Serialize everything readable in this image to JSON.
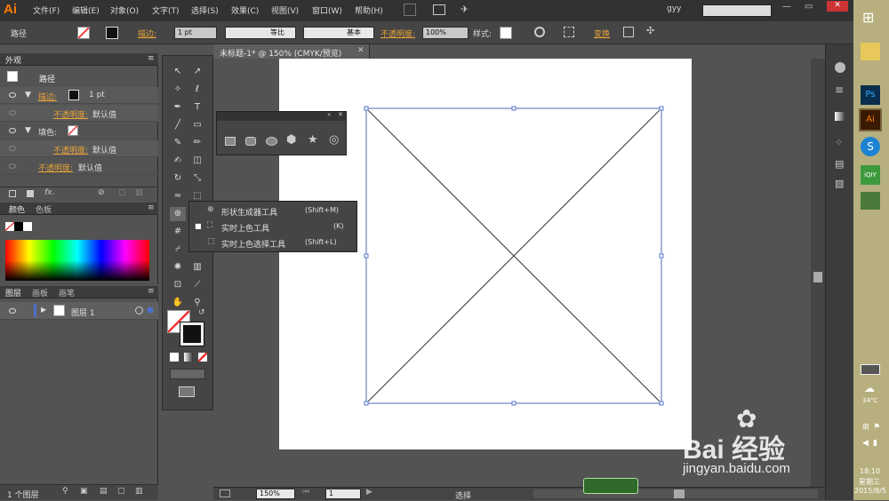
{
  "app": {
    "logo": "Ai"
  },
  "menubar": {
    "items": [
      "文件(F)",
      "编辑(E)",
      "对象(O)",
      "文字(T)",
      "选择(S)",
      "效果(C)",
      "视图(V)",
      "窗口(W)",
      "帮助(H)"
    ],
    "user": "gyy",
    "window_controls": [
      "—",
      "▭",
      "✕"
    ]
  },
  "control_bar": {
    "object_type": "路径",
    "stroke_label": "描边:",
    "stroke_weight": "1 pt",
    "stroke_profile": "等比",
    "brush": "基本",
    "opacity_label": "不透明度:",
    "opacity_value": "100%",
    "style_label": "样式:",
    "transform_label": "变换"
  },
  "appearance_panel": {
    "tab": "外观",
    "header": "路径",
    "rows": [
      {
        "label": "描边:",
        "value": "1 pt"
      },
      {
        "label": "不透明度:",
        "value": "默认值"
      },
      {
        "label": "填色:",
        "value": ""
      },
      {
        "label": "不透明度:",
        "value": "默认值"
      },
      {
        "label": "不透明度:",
        "value": "默认值"
      }
    ]
  },
  "color_panel": {
    "tabs": [
      "颜色",
      "色板"
    ]
  },
  "layers_panel": {
    "tabs": [
      "图层",
      "画板",
      "画笔"
    ],
    "layer_name": "图层 1",
    "count": "1 个图层"
  },
  "document": {
    "tab_title": "未标题-1* @ 150% (CMYK/预览)"
  },
  "flyout_menu": {
    "items": [
      {
        "label": "形状生成器工具",
        "shortcut": "(Shift+M)"
      },
      {
        "label": "实时上色工具",
        "shortcut": "(K)"
      },
      {
        "label": "实时上色选择工具",
        "shortcut": "(Shift+L)"
      }
    ]
  },
  "statusbar": {
    "zoom": "150%",
    "page": "1",
    "tool": "选择"
  },
  "taskbar": {
    "weather": "34°C",
    "time": "18:10",
    "day": "星期三",
    "date": "2015/8/5"
  },
  "watermark": {
    "brand": "Bai 经验",
    "url": "jingyan.baidu.com"
  },
  "colors": {
    "accent": "#ff7c00",
    "panel": "#535353",
    "dark": "#323232"
  }
}
